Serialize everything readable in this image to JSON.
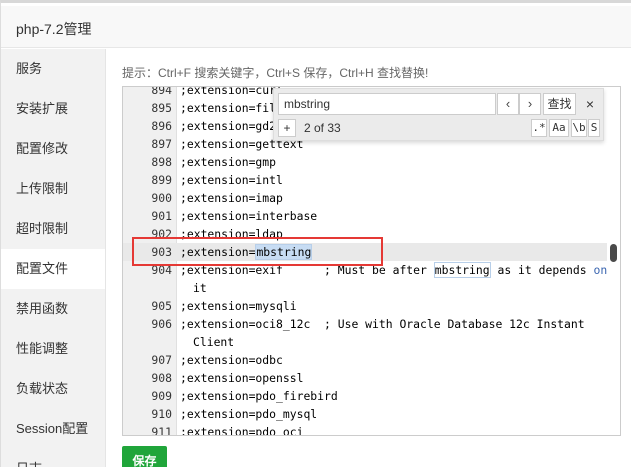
{
  "window": {
    "title": "php-7.2管理"
  },
  "sidebar": {
    "items": [
      {
        "label": "服务"
      },
      {
        "label": "安装扩展"
      },
      {
        "label": "配置修改"
      },
      {
        "label": "上传限制"
      },
      {
        "label": "超时限制"
      },
      {
        "label": "配置文件",
        "active": true
      },
      {
        "label": "禁用函数"
      },
      {
        "label": "性能调整"
      },
      {
        "label": "负载状态"
      },
      {
        "label": "Session配置"
      },
      {
        "label": "日志"
      }
    ]
  },
  "hint": "提示：Ctrl+F 搜索关键字，Ctrl+S 保存，Ctrl+H 查找替换!",
  "search": {
    "value": "mbstring",
    "prev_icon": "chevron-left-icon",
    "prev_label": "‹",
    "next_icon": "chevron-right-icon",
    "next_label": "›",
    "find_label": "查找",
    "close_label": "×",
    "toggle_replace_label": "+",
    "counter": "2 of 33",
    "opt_regex": ".*",
    "opt_case": "Aa",
    "opt_word": "\\b",
    "opt_selection": "S"
  },
  "editor": {
    "lines": [
      {
        "n": "894",
        "code": ";extension=curl"
      },
      {
        "n": "895",
        "code": ";extension=fileinfo"
      },
      {
        "n": "896",
        "code": ";extension=gd2"
      },
      {
        "n": "897",
        "code": ";extension=gettext"
      },
      {
        "n": "898",
        "code": ";extension=gmp"
      },
      {
        "n": "899",
        "code": ";extension=intl"
      },
      {
        "n": "900",
        "code": ";extension=imap"
      },
      {
        "n": "901",
        "code": ";extension=interbase"
      },
      {
        "n": "902",
        "code": ";extension=ldap"
      },
      {
        "n": "903",
        "code_prefix": ";extension=",
        "code_match": "mbstring"
      },
      {
        "n": "904",
        "code_prefix": ";extension=exif      ; Must be after ",
        "code_match": "mbstring",
        "code_suffix": " as it depends ",
        "code_kw": "on",
        "wrap": "it"
      },
      {
        "n": "905",
        "code": ";extension=mysqli"
      },
      {
        "n": "906",
        "code": ";extension=oci8_12c  ; Use with Oracle Database 12c Instant",
        "wrap": "Client"
      },
      {
        "n": "907",
        "code": ";extension=odbc"
      },
      {
        "n": "908",
        "code": ";extension=openssl"
      },
      {
        "n": "909",
        "code": ";extension=pdo_firebird"
      },
      {
        "n": "910",
        "code": ";extension=pdo_mysql"
      },
      {
        "n": "911",
        "code": ";extension=pdo_oci"
      }
    ]
  },
  "save_label": "保存",
  "colors": {
    "accent": "#20a53a",
    "highlight_box": "#e53935",
    "selection": "#c7dcf3"
  }
}
